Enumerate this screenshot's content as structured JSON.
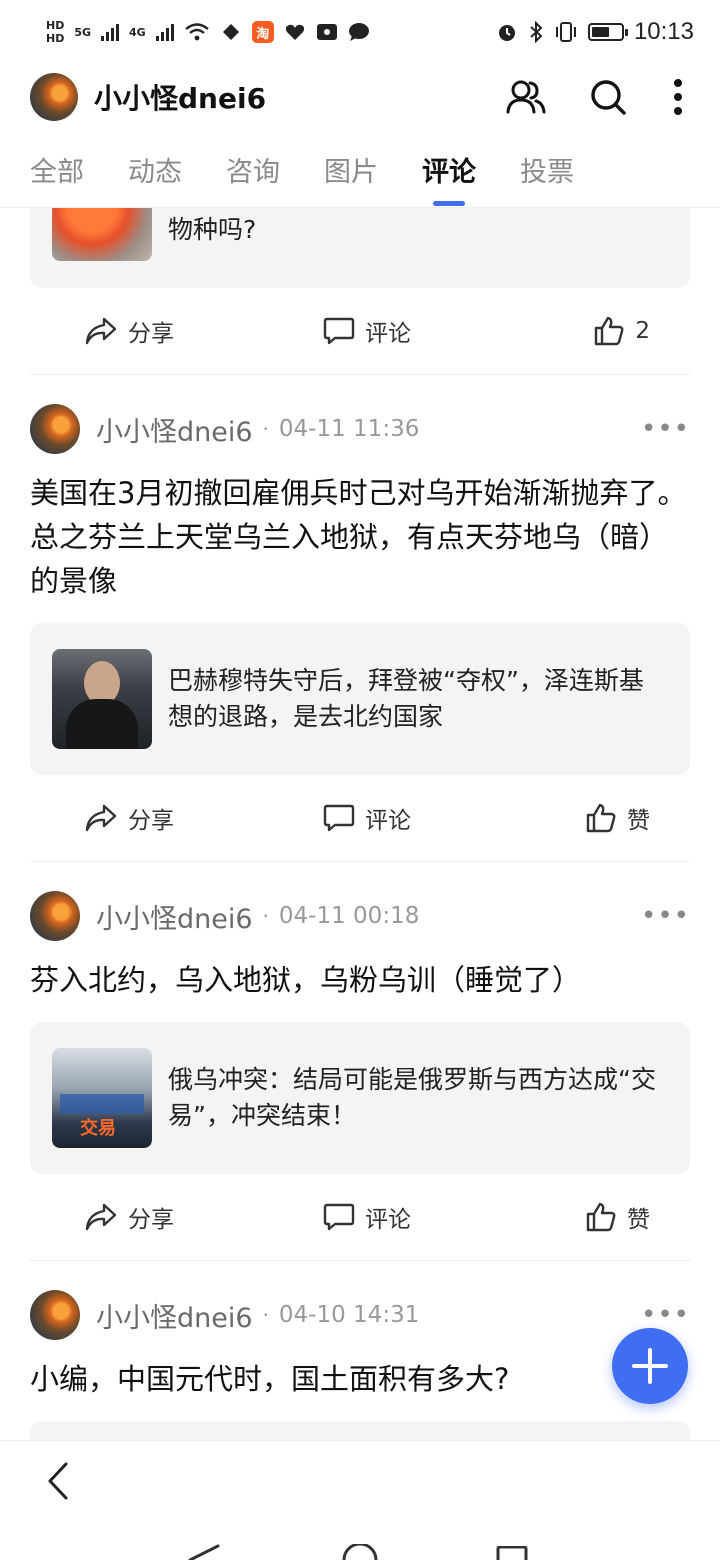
{
  "status_bar": {
    "network_tag_1": "HD",
    "network_tag_2": "HD",
    "gen_1": "5G",
    "gen_2": "4G",
    "taobao_label": "淘",
    "time": "10:13"
  },
  "header": {
    "title": "小小怪dnei6"
  },
  "tabs": [
    {
      "label": "全部",
      "active": false
    },
    {
      "label": "动态",
      "active": false
    },
    {
      "label": "咨询",
      "active": false
    },
    {
      "label": "图片",
      "active": false
    },
    {
      "label": "评论",
      "active": true
    },
    {
      "label": "投票",
      "active": false
    }
  ],
  "partial_card": {
    "text": "物种吗?",
    "share": "分享",
    "comment": "评论",
    "like": "2"
  },
  "posts": [
    {
      "author": "小小怪dnei6",
      "dot": "·",
      "time": "04-11 11:36",
      "body": "美国在3月初撤回雇佣兵时己对乌开始渐渐抛弃了。总之芬兰上天堂乌兰入地狱，有点天芬地乌（暗）的景像",
      "card_text": "巴赫穆特失守后，拜登被“夺权”，泽连斯基想的退路，是去北约国家",
      "share": "分享",
      "comment": "评论",
      "like": "赞"
    },
    {
      "author": "小小怪dnei6",
      "dot": "·",
      "time": "04-11 00:18",
      "body": "芬入北约，乌入地狱，乌粉乌训（睡觉了）",
      "card_text": "俄乌冲突：结局可能是俄罗斯与西方达成“交易”，冲突结束！",
      "thumb_caption": "交易",
      "share": "分享",
      "comment": "评论",
      "like": "赞"
    },
    {
      "author": "小小怪dnei6",
      "dot": "·",
      "time": "04-10 14:31",
      "body": "小编，中国元代时，国土面积有多大?"
    }
  ],
  "icons": {
    "header_people": "people-icon",
    "header_search": "search-icon",
    "header_more": "more-vertical-icon",
    "share": "share-arrow-icon",
    "comment": "comment-bubble-icon",
    "like": "thumbs-up-icon",
    "fab": "plus-icon",
    "back": "back-chevron-icon"
  },
  "colors": {
    "accent": "#3f6ef3",
    "tab_indicator": "#3d6ff0",
    "card_bg": "#f4f4f5"
  }
}
